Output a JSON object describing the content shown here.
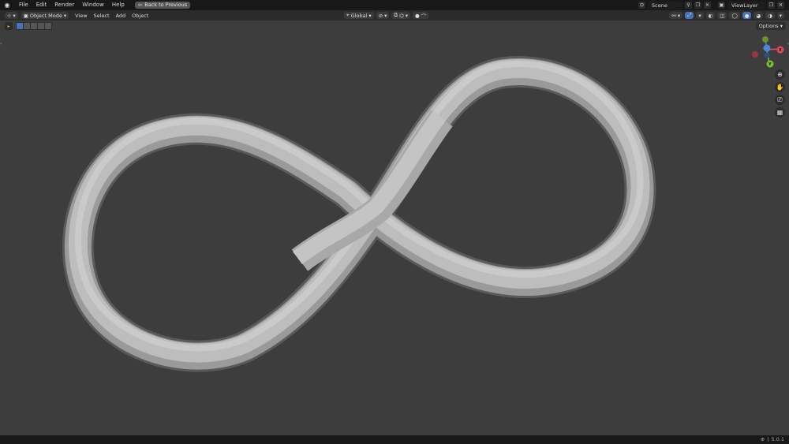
{
  "menubar": {
    "logo_icon": "blender-logo-icon",
    "items": [
      "File",
      "Edit",
      "Render",
      "Window",
      "Help"
    ],
    "back_label": "Back to Previous",
    "scene_label": "Scene",
    "viewlayer_label": "ViewLayer"
  },
  "header": {
    "mode_label": "Object Mode",
    "menus": [
      "View",
      "Select",
      "Add",
      "Object"
    ],
    "orientation_label": "Global"
  },
  "viewport": {
    "options_label": "Options",
    "gizmo": {
      "x_label": "X",
      "y_label": "Y",
      "z_label": "Z"
    }
  },
  "statusbar": {
    "version": "5.0.1"
  },
  "colors": {
    "viewport_bg": "#3d3d3d",
    "axis_x": "#e34a5a",
    "axis_y": "#7fbf2a",
    "axis_z": "#4f86d9",
    "accent": "#4772b3"
  }
}
